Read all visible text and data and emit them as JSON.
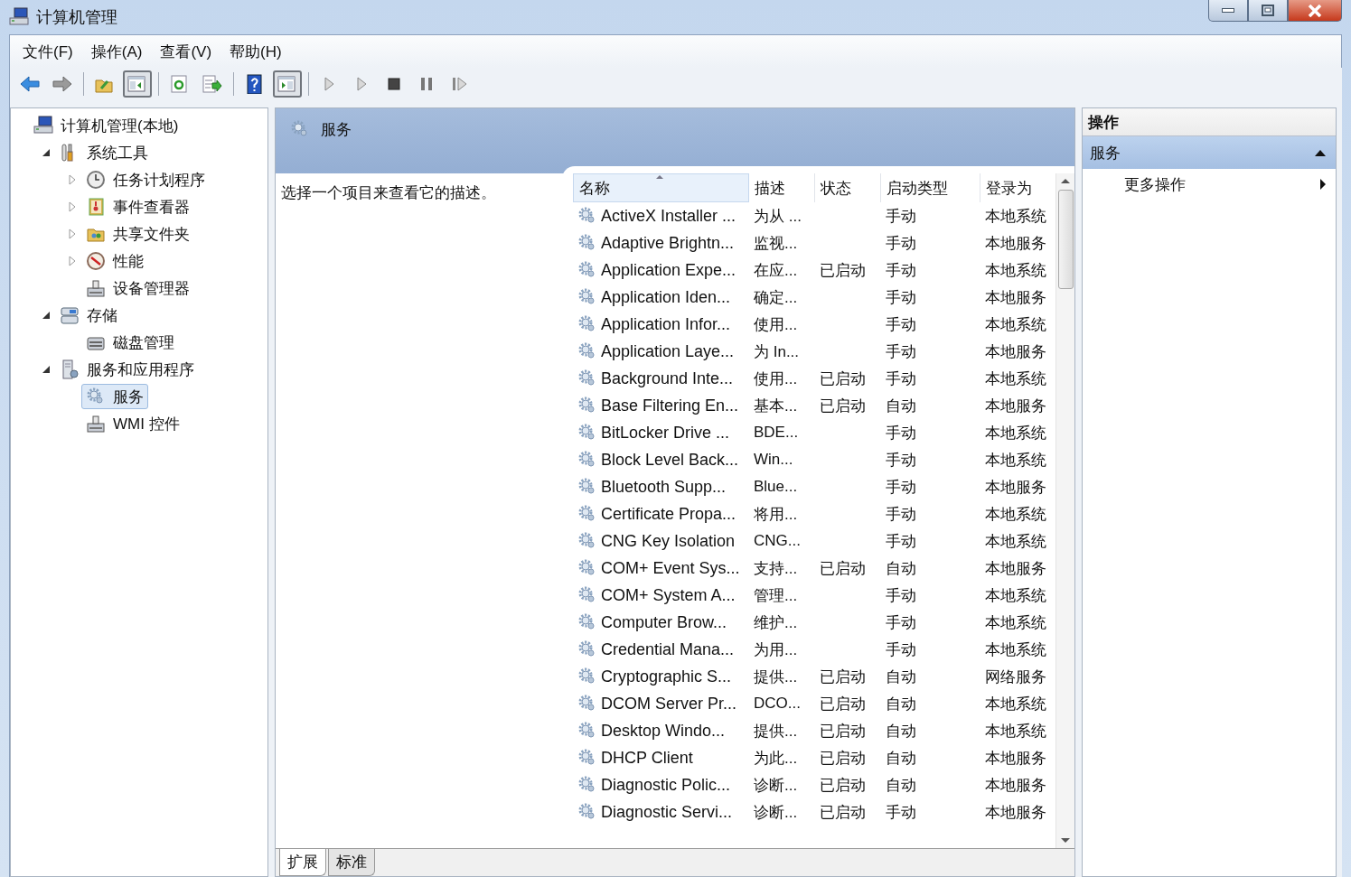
{
  "window": {
    "title": "计算机管理"
  },
  "menu": [
    "文件(F)",
    "操作(A)",
    "查看(V)",
    "帮助(H)"
  ],
  "toolbar": [
    {
      "kind": "back",
      "pressed": false
    },
    {
      "kind": "forward",
      "pressed": false
    },
    {
      "kind": "sep"
    },
    {
      "kind": "up",
      "pressed": false
    },
    {
      "kind": "tree",
      "pressed": true
    },
    {
      "kind": "sep"
    },
    {
      "kind": "refresh",
      "pressed": false
    },
    {
      "kind": "export",
      "pressed": false
    },
    {
      "kind": "sep"
    },
    {
      "kind": "help",
      "pressed": false
    },
    {
      "kind": "pane",
      "pressed": true
    },
    {
      "kind": "sep"
    },
    {
      "kind": "play",
      "pressed": false
    },
    {
      "kind": "play",
      "pressed": false
    },
    {
      "kind": "stop",
      "pressed": false
    },
    {
      "kind": "pause",
      "pressed": false
    },
    {
      "kind": "resume",
      "pressed": false
    }
  ],
  "tree": {
    "label": "计算机管理(本地)",
    "selected": false,
    "children": [
      {
        "label": "系统工具",
        "selected": false,
        "expanded": true,
        "children": [
          {
            "label": "任务计划程序",
            "selected": false,
            "expanded": false
          },
          {
            "label": "事件查看器",
            "selected": false,
            "expanded": false
          },
          {
            "label": "共享文件夹",
            "selected": false,
            "expanded": false
          },
          {
            "label": "性能",
            "selected": false,
            "expanded": false
          },
          {
            "label": "设备管理器",
            "selected": false
          }
        ]
      },
      {
        "label": "存储",
        "selected": false,
        "expanded": true,
        "children": [
          {
            "label": "磁盘管理",
            "selected": false
          }
        ]
      },
      {
        "label": "服务和应用程序",
        "selected": false,
        "expanded": true,
        "children": [
          {
            "label": "服务",
            "selected": true
          },
          {
            "label": "WMI 控件",
            "selected": false
          }
        ]
      }
    ]
  },
  "services": {
    "title": "服务",
    "description": "选择一个项目来查看它的描述。",
    "columns": [
      {
        "label": "名称",
        "sorted": true
      },
      {
        "label": "描述",
        "sorted": false
      },
      {
        "label": "状态",
        "sorted": false
      },
      {
        "label": "启动类型",
        "sorted": false
      },
      {
        "label": "登录为",
        "sorted": false
      }
    ],
    "rows": [
      {
        "name": "ActiveX Installer ...",
        "description": "为从 ...",
        "startup": "手动",
        "logon": "本地系统"
      },
      {
        "name": "Adaptive Brightn...",
        "description": "监视...",
        "startup": "手动",
        "logon": "本地服务"
      },
      {
        "name": "Application Expe...",
        "description": "在应...",
        "status": "已启动",
        "startup": "手动",
        "logon": "本地系统"
      },
      {
        "name": "Application Iden...",
        "description": "确定...",
        "startup": "手动",
        "logon": "本地服务"
      },
      {
        "name": "Application Infor...",
        "description": "使用...",
        "startup": "手动",
        "logon": "本地系统"
      },
      {
        "name": "Application Laye...",
        "description": "为 In...",
        "startup": "手动",
        "logon": "本地服务"
      },
      {
        "name": "Background Inte...",
        "description": "使用...",
        "status": "已启动",
        "startup": "手动",
        "logon": "本地系统"
      },
      {
        "name": "Base Filtering En...",
        "description": "基本...",
        "status": "已启动",
        "startup": "自动",
        "logon": "本地服务"
      },
      {
        "name": "BitLocker Drive ...",
        "description": "BDE...",
        "startup": "手动",
        "logon": "本地系统"
      },
      {
        "name": "Block Level Back...",
        "description": "Win...",
        "startup": "手动",
        "logon": "本地系统"
      },
      {
        "name": "Bluetooth Supp...",
        "description": "Blue...",
        "startup": "手动",
        "logon": "本地服务"
      },
      {
        "name": "Certificate Propa...",
        "description": "将用...",
        "startup": "手动",
        "logon": "本地系统"
      },
      {
        "name": "CNG Key Isolation",
        "description": "CNG...",
        "startup": "手动",
        "logon": "本地系统"
      },
      {
        "name": "COM+ Event Sys...",
        "description": "支持...",
        "status": "已启动",
        "startup": "自动",
        "logon": "本地服务"
      },
      {
        "name": "COM+ System A...",
        "description": "管理...",
        "startup": "手动",
        "logon": "本地系统"
      },
      {
        "name": "Computer Brow...",
        "description": "维护...",
        "startup": "手动",
        "logon": "本地系统"
      },
      {
        "name": "Credential Mana...",
        "description": "为用...",
        "startup": "手动",
        "logon": "本地系统"
      },
      {
        "name": "Cryptographic S...",
        "description": "提供...",
        "status": "已启动",
        "startup": "自动",
        "logon": "网络服务"
      },
      {
        "name": "DCOM Server Pr...",
        "description": "DCO...",
        "status": "已启动",
        "startup": "自动",
        "logon": "本地系统"
      },
      {
        "name": "Desktop Windo...",
        "description": "提供...",
        "status": "已启动",
        "startup": "自动",
        "logon": "本地系统"
      },
      {
        "name": "DHCP Client",
        "description": "为此...",
        "status": "已启动",
        "startup": "自动",
        "logon": "本地服务"
      },
      {
        "name": "Diagnostic Polic...",
        "description": "诊断...",
        "status": "已启动",
        "startup": "自动",
        "logon": "本地服务"
      },
      {
        "name": "Diagnostic Servi...",
        "description": "诊断...",
        "status": "已启动",
        "startup": "手动",
        "logon": "本地服务"
      }
    ],
    "tabs": [
      {
        "label": "扩展",
        "selected": true
      },
      {
        "label": "标准",
        "selected": false
      }
    ]
  },
  "actions": {
    "title": "操作",
    "section": {
      "label": "服务",
      "expanded": true
    },
    "items": [
      {
        "label": "更多操作"
      }
    ]
  }
}
